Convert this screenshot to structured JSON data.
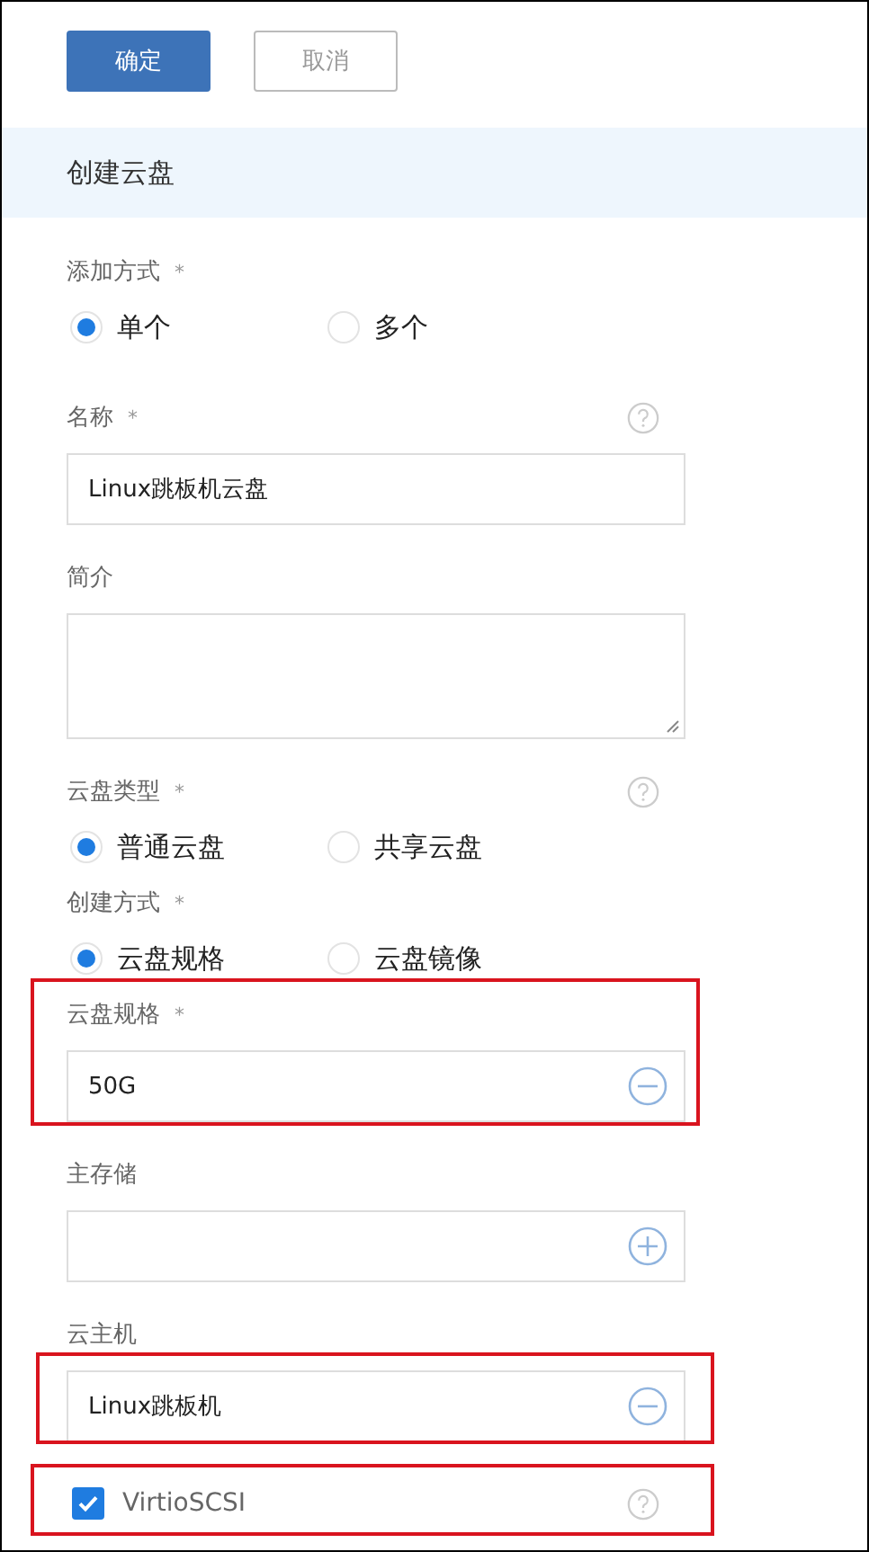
{
  "buttons": [
    {
      "label": "确定",
      "kind": "primary"
    },
    {
      "label": "取消",
      "kind": "secondary"
    }
  ],
  "section_title": "创建云盘",
  "fields": [
    {
      "kind": "radio",
      "label": "添加方式",
      "mark": "*",
      "help": false,
      "options": [
        {
          "label": "单个",
          "selected": true
        },
        {
          "label": "多个",
          "selected": false
        }
      ]
    },
    {
      "kind": "input",
      "label": "名称",
      "mark": "*",
      "help": true,
      "value": "Linux跳板机云盘"
    },
    {
      "kind": "textarea",
      "label": "简介",
      "help": false
    },
    {
      "kind": "radio",
      "label": "云盘类型",
      "mark": "*",
      "help": true,
      "options": [
        {
          "label": "普通云盘",
          "selected": true
        },
        {
          "label": "共享云盘",
          "selected": false
        }
      ]
    },
    {
      "kind": "radio",
      "label": "创建方式",
      "mark": "*",
      "help": false,
      "options": [
        {
          "label": "云盘规格",
          "selected": true
        },
        {
          "label": "云盘镜像",
          "selected": false
        }
      ]
    },
    {
      "kind": "picker",
      "label": "云盘规格",
      "mark": "*",
      "help": false,
      "value": "50G",
      "removable": true,
      "highlighted": true
    },
    {
      "kind": "picker",
      "label": "主存储",
      "help": false,
      "removable": false
    },
    {
      "kind": "picker",
      "label": "云主机",
      "help": false,
      "value": "Linux跳板机",
      "removable": true,
      "control_highlighted": true
    },
    {
      "kind": "checkbox",
      "label": "VirtioSCSI",
      "checked": true,
      "help": true,
      "highlighted": true
    }
  ]
}
